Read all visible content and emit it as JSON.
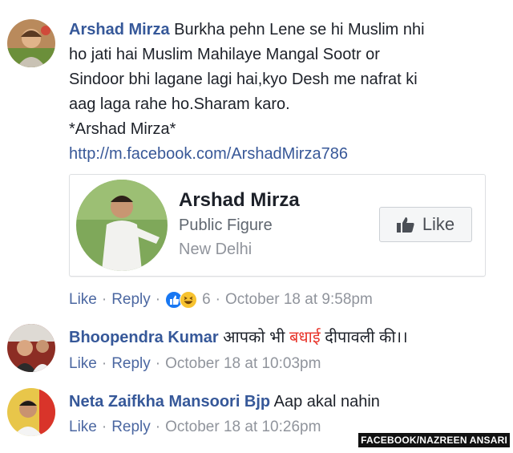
{
  "comments": [
    {
      "author": "Arshad Mirza",
      "lines": [
        "Burkha pehn Lene se hi Muslim nhi",
        "ho jati hai Muslim Mahilaye Mangal Sootr or",
        "Sindoor bhi lagane lagi hai,kyo Desh me nafrat ki",
        "aag laga rahe ho.Sharam karo.",
        "*Arshad Mirza*"
      ],
      "link": "http://m.facebook.com/ArshadMirza786",
      "like": "Like",
      "reply": "Reply",
      "reaction_count": "6",
      "timestamp": "October 18 at 9:58pm",
      "reaction_icons": [
        "like-icon",
        "haha-icon"
      ]
    },
    {
      "author": "Bhoopendra Kumar",
      "text_before": "आपको भी",
      "text_accent": "बधाई",
      "text_after": "दीपावली की।।",
      "like": "Like",
      "reply": "Reply",
      "timestamp": "October 18 at 10:03pm"
    },
    {
      "author": "Neta Zaifkha Mansoori Bjp",
      "text": "Aap akal nahin",
      "like": "Like",
      "reply": "Reply",
      "timestamp": "October 18 at 10:26pm"
    }
  ],
  "shared_card": {
    "name": "Arshad Mirza",
    "category": "Public Figure",
    "location": "New Delhi",
    "like_button": "Like"
  },
  "watermark": "FACEBOOK/NAZREEN ANSARI",
  "colors": {
    "author_link": "#365899",
    "meta_gray": "#90949c",
    "action_blue": "#4b67a1",
    "accent_red": "#e8352b"
  }
}
